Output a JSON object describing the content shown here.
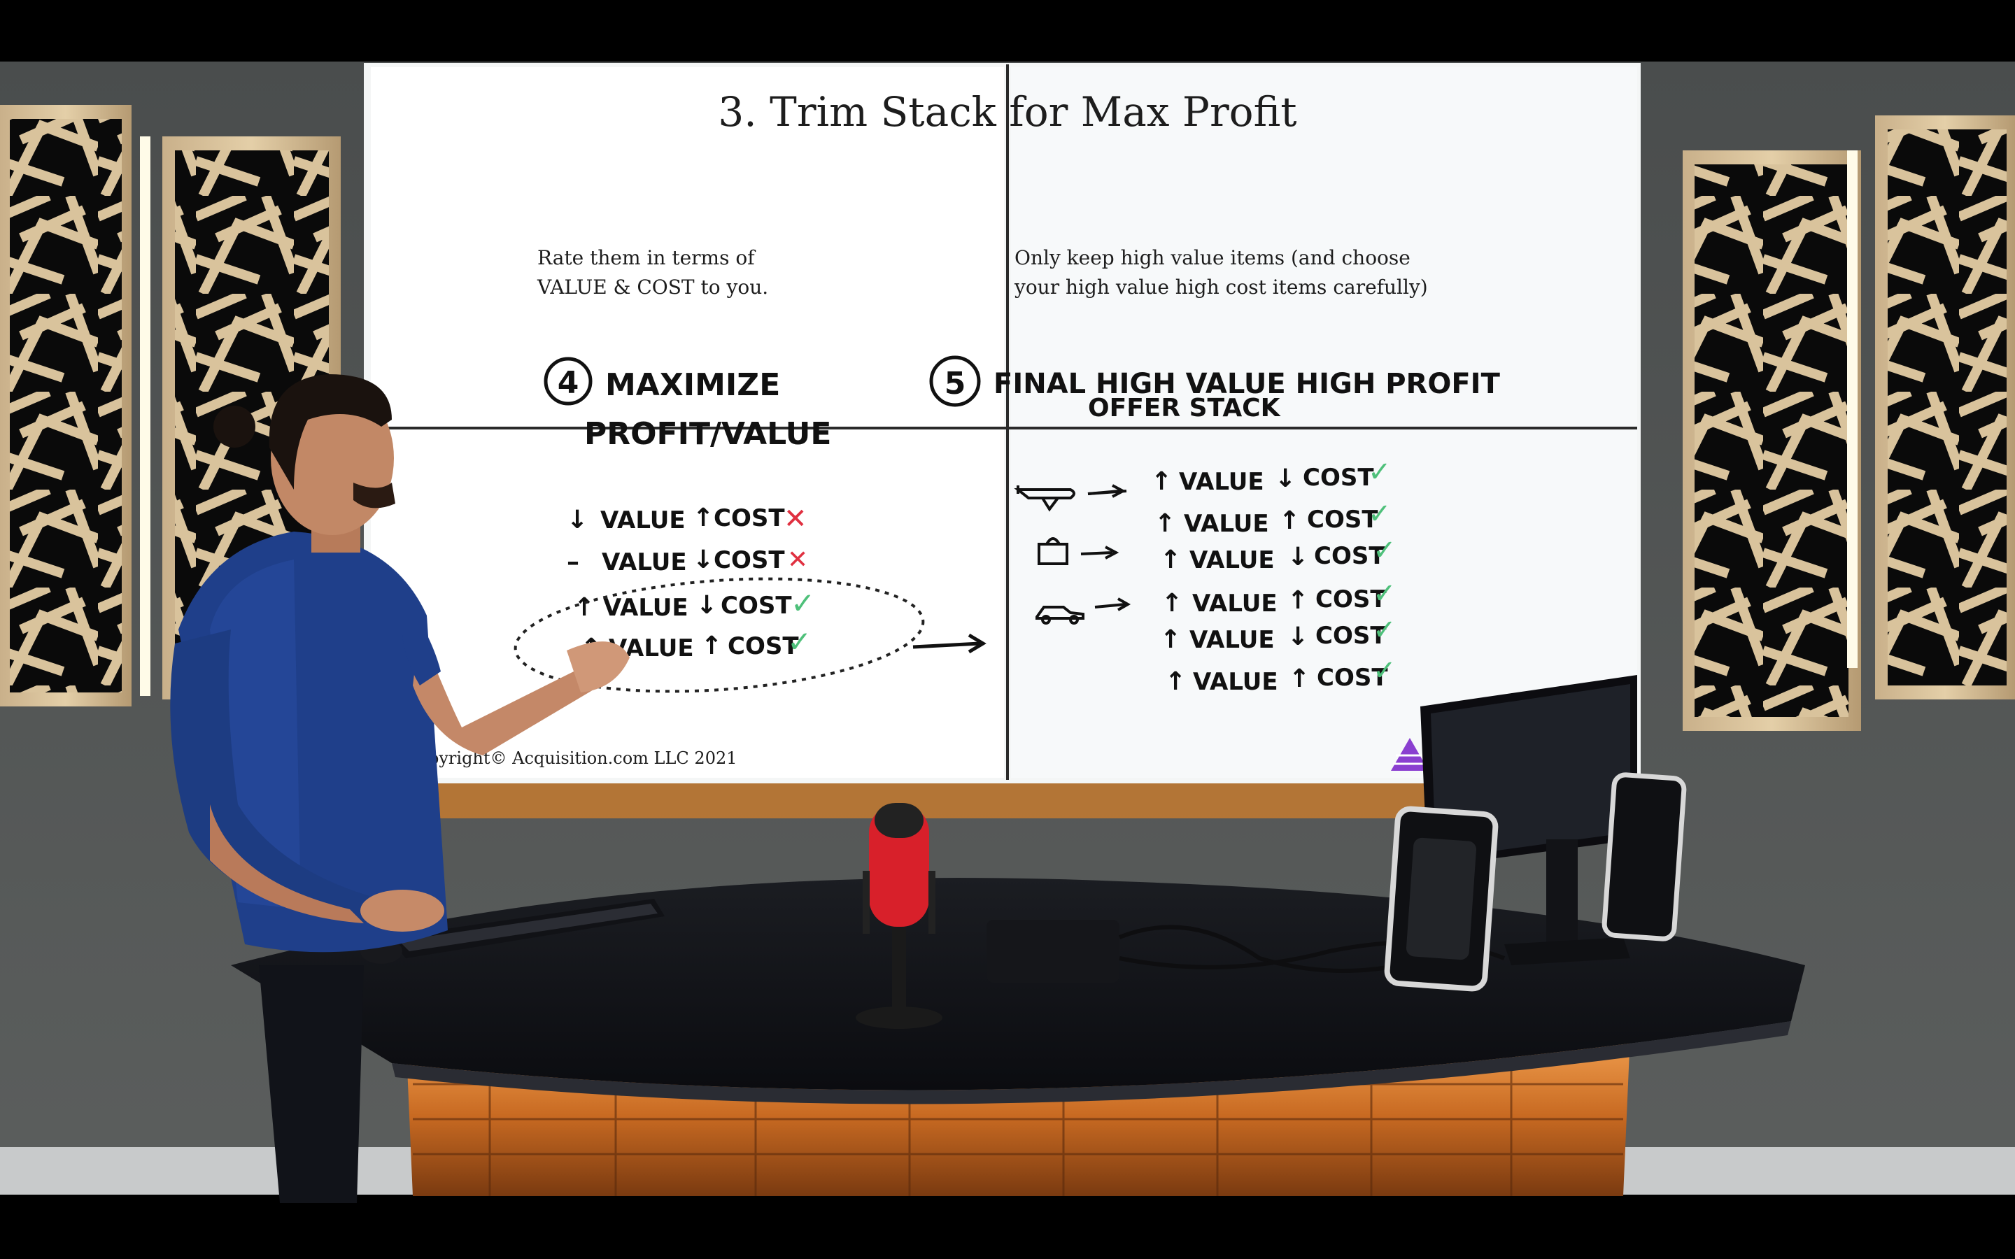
{
  "slide": {
    "title": "3. Trim Stack for Max Profit",
    "left_instruction_1": "Rate them in terms of",
    "left_instruction_2": "VALUE & COST to you.",
    "right_instruction_1": "Only keep high value items (and choose",
    "right_instruction_2": "your high value high cost items carefully)",
    "copyright": "pyright© Acquisition.com LLC 2021"
  },
  "handwriting": {
    "step4_number": "4",
    "step4_line1": "MAXIMIZE",
    "step4_line2": "PROFIT/VALUE",
    "step5_number": "5",
    "step5_line1": "FINAL HIGH VALUE HIGH PROFIT",
    "step5_line2": "OFFER STACK",
    "left_rows": [
      {
        "arrow": "↓",
        "value": "VALUE",
        "cost_arrow": "↑",
        "cost": "COST",
        "mark": "✕"
      },
      {
        "arrow": "–",
        "value": "VALUE",
        "cost_arrow": "↓",
        "cost": "COST",
        "mark": "✕"
      },
      {
        "arrow": "↑",
        "value": "VALUE",
        "cost_arrow": "↓",
        "cost": "COST",
        "mark": "✓"
      },
      {
        "arrow": "↑",
        "value": "VALUE",
        "cost_arrow": "↑",
        "cost": "COST",
        "mark": "✓"
      }
    ],
    "right_rows": [
      {
        "arrow": "↑",
        "value": "VALUE",
        "cost_arrow": "↓",
        "cost": "COST",
        "mark": "✓"
      },
      {
        "arrow": "↑",
        "value": "VALUE",
        "cost_arrow": "↑",
        "cost": "COST",
        "mark": "✓"
      },
      {
        "arrow": "↑",
        "value": "VALUE",
        "cost_arrow": "↓",
        "cost": "COST",
        "mark": "✓"
      },
      {
        "arrow": "↑",
        "value": "VALUE",
        "cost_arrow": "↑",
        "cost": "COST",
        "mark": "✓"
      },
      {
        "arrow": "↑",
        "value": "VALUE",
        "cost_arrow": "↓",
        "cost": "COST",
        "mark": "✓"
      },
      {
        "arrow": "↑",
        "value": "VALUE",
        "cost_arrow": "↑",
        "cost": "COST",
        "mark": "✓"
      }
    ]
  },
  "icons": [
    "airplane-icon",
    "shopping-bag-icon",
    "car-icon",
    "pyramid-logo-icon",
    "microphone-icon",
    "keyboard-icon",
    "computer-monitor-icon",
    "speaker-icon"
  ],
  "colors": {
    "cross_mark": "#e03040",
    "check_mark": "#4ec07a",
    "logo": "#8a3fd0",
    "microphone": "#d8202a",
    "wood_glow": "#e08a3a"
  }
}
